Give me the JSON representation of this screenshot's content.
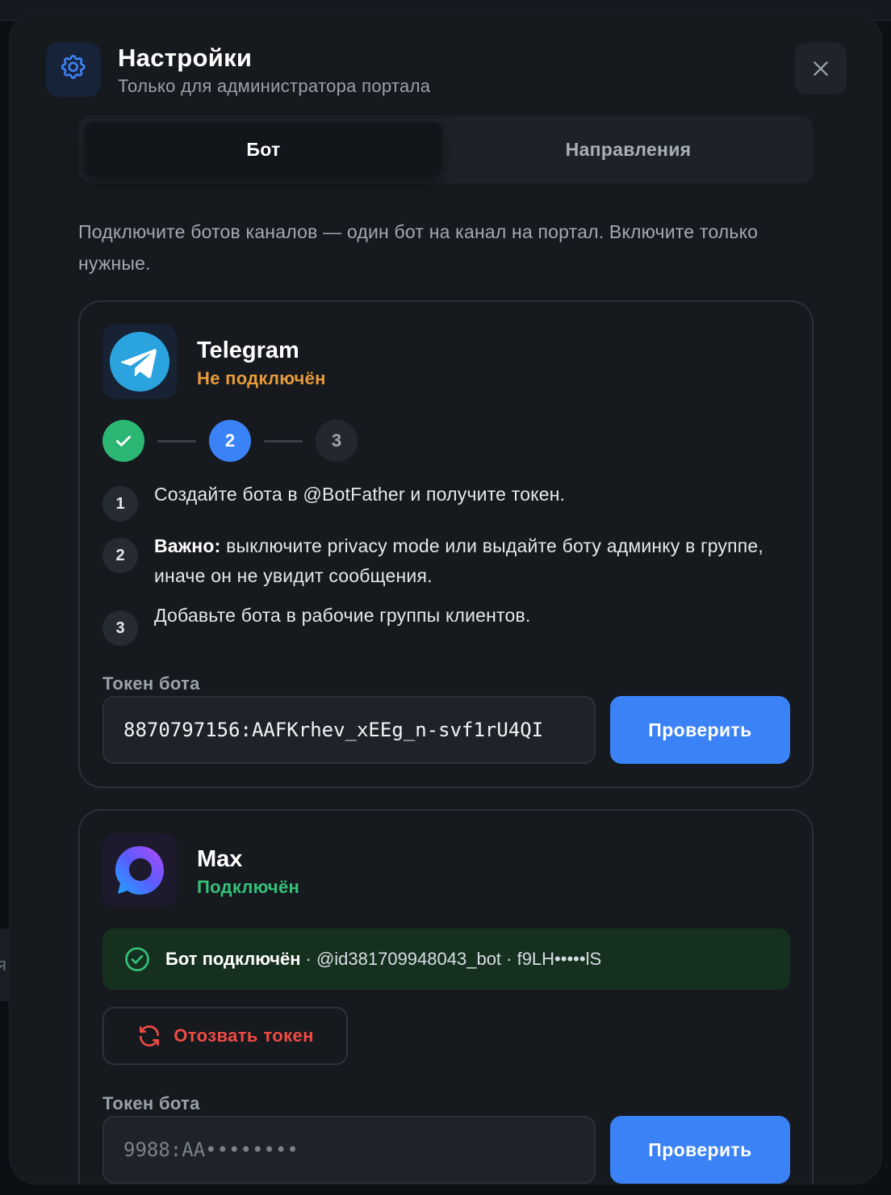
{
  "background": {
    "left_tab_text": "я"
  },
  "header": {
    "icon": "gear-icon",
    "title": "Настройки",
    "subtitle": "Только для администратора портала",
    "close_icon": "close-icon"
  },
  "tabs": [
    {
      "label": "Бот",
      "active": true
    },
    {
      "label": "Направления",
      "active": false
    }
  ],
  "intro": "Подключите ботов каналов — один бот на канал на портал. Включите только нужные.",
  "telegram": {
    "name": "Telegram",
    "status": "Не подключён",
    "status_color": "#e79b3a",
    "icon": "telegram-icon",
    "stepper": {
      "steps": [
        "✓",
        "2",
        "3"
      ],
      "current": 2
    },
    "instructions": [
      {
        "num": "1",
        "bold": "",
        "text": "Создайте бота в @BotFather и получите токен."
      },
      {
        "num": "2",
        "bold": "Важно:",
        "text": " выключите privacy mode или выдайте боту админку в группе, иначе он не увидит сообщения."
      },
      {
        "num": "3",
        "bold": "",
        "text": "Добавьте бота в рабочие группы клиентов."
      }
    ],
    "token_label": "Токен бота",
    "token_value": "8870797156:AAFKrhev_xEEg_n-svf1rU4QI",
    "check_label": "Проверить"
  },
  "max": {
    "name": "Max",
    "status": "Подключён",
    "status_color": "#34c27a",
    "icon": "max-icon",
    "banner": {
      "icon": "check-circle-icon",
      "bold": "Бот подключён",
      "details": " · @id381709948043_bot · f9LH•••••lS"
    },
    "revoke_label": "Отозвать токен",
    "revoke_icon": "refresh-icon",
    "token_label": "Токен бота",
    "token_placeholder": "9988:AA••••••••",
    "check_label": "Проверить"
  },
  "colors": {
    "accent": "#3b82f6",
    "success": "#2bb673",
    "warning": "#e79b3a",
    "danger": "#ef4b44"
  }
}
